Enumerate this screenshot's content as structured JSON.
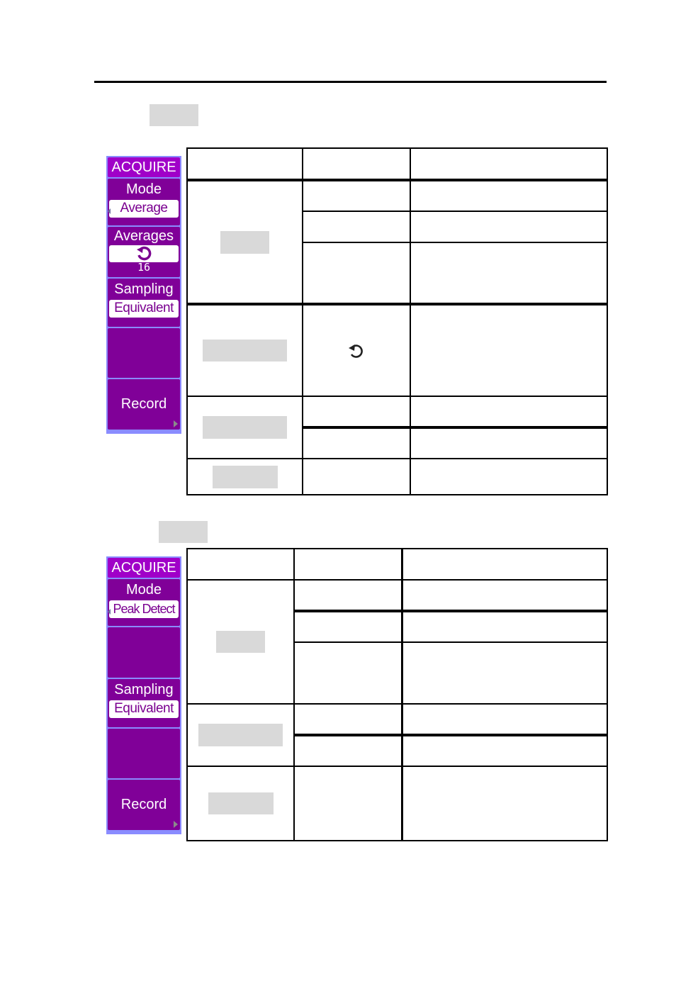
{
  "header": {
    "rule": true
  },
  "section1": {
    "heading_redacted": true,
    "panel": {
      "title": "ACQUIRE",
      "mode_label": "Mode",
      "mode_value": "Average",
      "averages_label": "Averages",
      "averages_icon": "rotate-knob-icon",
      "averages_value": "16",
      "sampling_label": "Sampling",
      "sampling_value": "Equivalent",
      "record_label": "Record",
      "colors": {
        "panel": "#800098",
        "title": "#a000c8",
        "border": "#8a8cff",
        "pill_text": "#7a0090"
      }
    },
    "table": {
      "columns": [
        "",
        "",
        ""
      ],
      "groups": [
        {
          "name_redacted": true,
          "rows": [
            {
              "option": "",
              "desc": ""
            },
            {
              "option": "",
              "desc": ""
            },
            {
              "option": "",
              "desc": ""
            }
          ]
        },
        {
          "name_redacted": true,
          "rows": [
            {
              "option_icon": "rotate-knob-icon",
              "desc": ""
            }
          ]
        },
        {
          "name_redacted": true,
          "rows": [
            {
              "option": "",
              "desc": ""
            },
            {
              "option": "",
              "desc": ""
            }
          ]
        },
        {
          "name_redacted": true,
          "rows": [
            {
              "option": "",
              "desc": ""
            }
          ]
        }
      ]
    }
  },
  "section2": {
    "heading_redacted": true,
    "panel": {
      "title": "ACQUIRE",
      "mode_label": "Mode",
      "mode_value": "Peak Detect",
      "sampling_label": "Sampling",
      "sampling_value": "Equivalent",
      "record_label": "Record"
    },
    "table": {
      "columns": [
        "",
        "",
        ""
      ],
      "groups": [
        {
          "name_redacted": true,
          "rows": [
            {
              "option": "",
              "desc": ""
            },
            {
              "option": "",
              "desc": ""
            },
            {
              "option": "",
              "desc": ""
            }
          ]
        },
        {
          "name_redacted": true,
          "rows": [
            {
              "option": "",
              "desc": ""
            },
            {
              "option": "",
              "desc": ""
            }
          ]
        },
        {
          "name_redacted": true,
          "rows": [
            {
              "option": "",
              "desc": ""
            }
          ]
        }
      ]
    }
  }
}
